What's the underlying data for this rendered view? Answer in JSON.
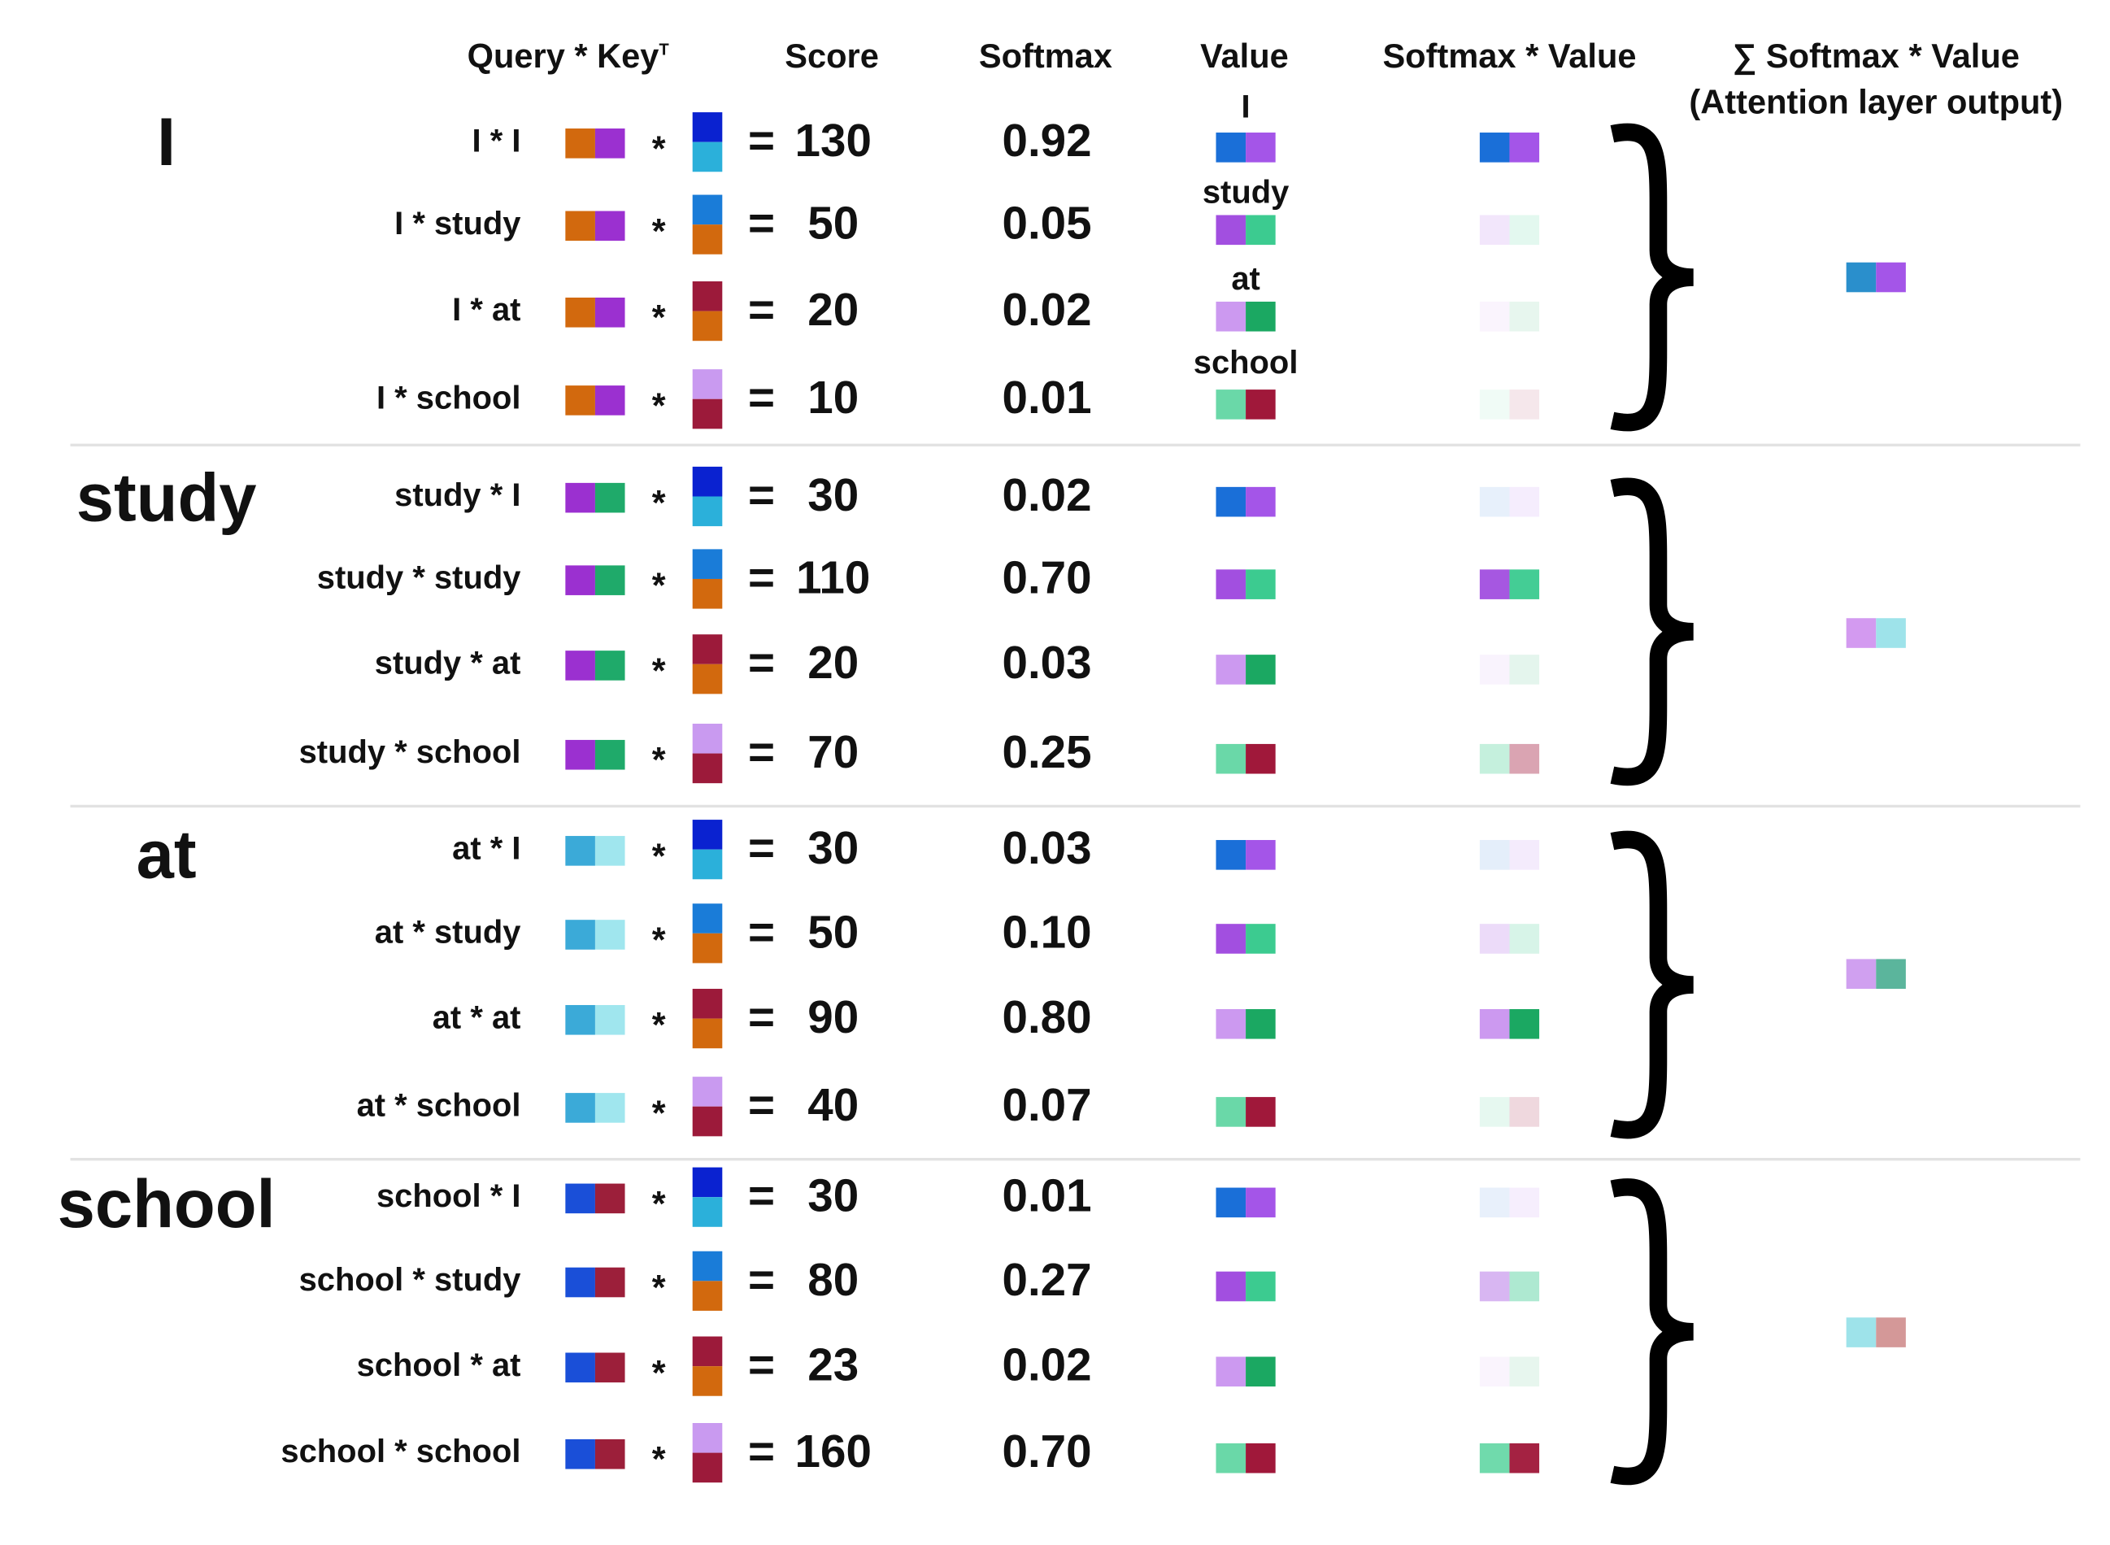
{
  "headers": {
    "query_key": "Query * Key",
    "query_key_sup": "T",
    "score": "Score",
    "softmax": "Softmax",
    "value": "Value",
    "softmax_value": "Softmax * Value",
    "sum": "∑ Softmax * Value",
    "sum_sub": "(Attention layer output)"
  },
  "symbols": {
    "star": "*",
    "equals": "="
  },
  "value_labels": [
    "I",
    "study",
    "at",
    "school"
  ],
  "colors": {
    "query": {
      "I": [
        "#D2690E",
        "#9B30D0"
      ],
      "study": [
        "#9B30D0",
        "#1FAA6A"
      ],
      "at": [
        "#3BAAD8",
        "#A0E6EE"
      ],
      "school": [
        "#1A4FD8",
        "#9C1F3A"
      ]
    },
    "key": {
      "I": [
        "#0A22D0",
        "#2BB0DA"
      ],
      "study": [
        "#1A7CD8",
        "#D2690E"
      ],
      "at": [
        "#9C1A3A",
        "#D2690E"
      ],
      "school": [
        "#C99AF0",
        "#9C1A3A"
      ]
    },
    "value": {
      "I": [
        "#1A6FD8",
        "#A455E8"
      ],
      "study": [
        "#A24FE0",
        "#3CCB90"
      ],
      "at": [
        "#CC99F0",
        "#1BA862"
      ],
      "school": [
        "#6AD8A8",
        "#A0183A"
      ]
    },
    "output": {
      "I": [
        "#2A8FCC",
        "#A455E8"
      ],
      "study": [
        "#D39AF0",
        "#9EE3EA"
      ],
      "at": [
        "#D0A0F0",
        "#5BB59C"
      ],
      "school": [
        "#9EE3EA",
        "#D49898"
      ]
    }
  },
  "groups": [
    {
      "word": "I",
      "rows": [
        {
          "label": "I * I",
          "key": "I",
          "score": "130",
          "softmax": "0.92"
        },
        {
          "label": "I * study",
          "key": "study",
          "score": "50",
          "softmax": "0.05"
        },
        {
          "label": "I * at",
          "key": "at",
          "score": "20",
          "softmax": "0.02"
        },
        {
          "label": "I * school",
          "key": "school",
          "score": "10",
          "softmax": "0.01"
        }
      ]
    },
    {
      "word": "study",
      "rows": [
        {
          "label": "study * I",
          "key": "I",
          "score": "30",
          "softmax": "0.02"
        },
        {
          "label": "study * study",
          "key": "study",
          "score": "110",
          "softmax": "0.70"
        },
        {
          "label": "study * at",
          "key": "at",
          "score": "20",
          "softmax": "0.03"
        },
        {
          "label": "study * school",
          "key": "school",
          "score": "70",
          "softmax": "0.25"
        }
      ]
    },
    {
      "word": "at",
      "rows": [
        {
          "label": "at * I",
          "key": "I",
          "score": "30",
          "softmax": "0.03"
        },
        {
          "label": "at * study",
          "key": "study",
          "score": "50",
          "softmax": "0.10"
        },
        {
          "label": "at * at",
          "key": "at",
          "score": "90",
          "softmax": "0.80"
        },
        {
          "label": "at * school",
          "key": "school",
          "score": "40",
          "softmax": "0.07"
        }
      ]
    },
    {
      "word": "school",
      "rows": [
        {
          "label": "school * I",
          "key": "I",
          "score": "30",
          "softmax": "0.01"
        },
        {
          "label": "school * study",
          "key": "study",
          "score": "80",
          "softmax": "0.27"
        },
        {
          "label": "school * at",
          "key": "at",
          "score": "23",
          "softmax": "0.02"
        },
        {
          "label": "school * school",
          "key": "school",
          "score": "160",
          "softmax": "0.70"
        }
      ]
    }
  ]
}
